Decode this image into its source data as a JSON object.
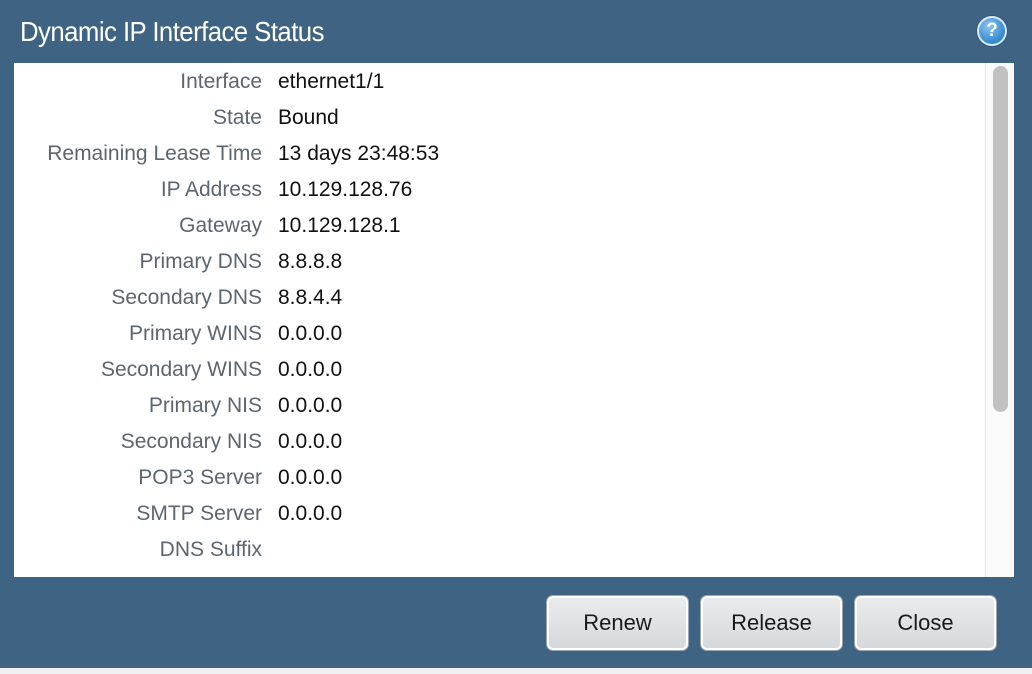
{
  "dialog": {
    "title": "Dynamic IP Interface Status",
    "help_icon_text": "?"
  },
  "fields": [
    {
      "label": "Interface",
      "value": "ethernet1/1"
    },
    {
      "label": "State",
      "value": "Bound"
    },
    {
      "label": "Remaining Lease Time",
      "value": "13 days 23:48:53"
    },
    {
      "label": "IP Address",
      "value": "10.129.128.76"
    },
    {
      "label": "Gateway",
      "value": "10.129.128.1"
    },
    {
      "label": "Primary DNS",
      "value": "8.8.8.8"
    },
    {
      "label": "Secondary DNS",
      "value": "8.8.4.4"
    },
    {
      "label": "Primary WINS",
      "value": "0.0.0.0"
    },
    {
      "label": "Secondary WINS",
      "value": "0.0.0.0"
    },
    {
      "label": "Primary NIS",
      "value": "0.0.0.0"
    },
    {
      "label": "Secondary NIS",
      "value": "0.0.0.0"
    },
    {
      "label": "POP3 Server",
      "value": "0.0.0.0"
    },
    {
      "label": "SMTP Server",
      "value": "0.0.0.0"
    },
    {
      "label": "DNS Suffix",
      "value": ""
    }
  ],
  "buttons": {
    "renew": "Renew",
    "release": "Release",
    "close": "Close"
  },
  "colors": {
    "header_bg": "#3f6383",
    "label_text": "#5c6670",
    "value_text": "#111111"
  }
}
